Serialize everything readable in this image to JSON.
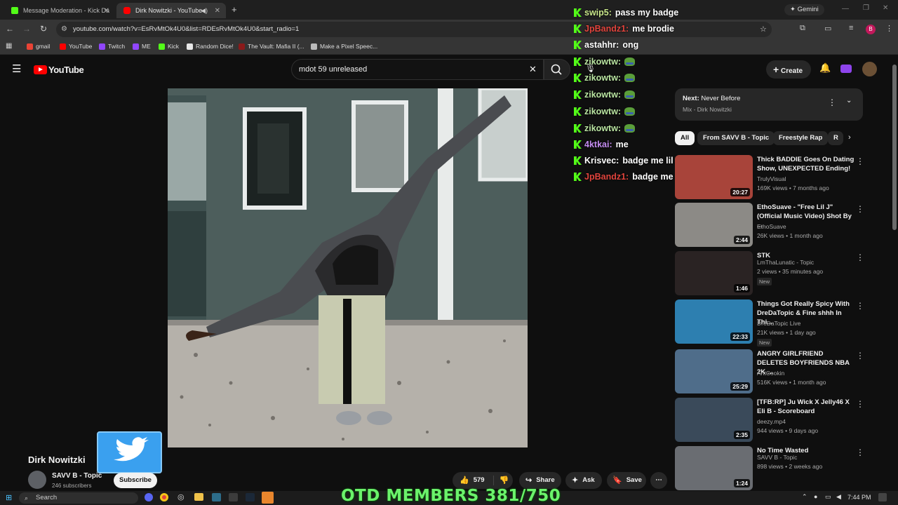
{
  "browser": {
    "tabs": [
      {
        "label": "Message Moderation - Kick Da",
        "active": false
      },
      {
        "label": "Dirk Nowitzki - YouTube",
        "active": true
      }
    ],
    "url": "youtube.com/watch?v=EsRvMtOk4U0&list=RDEsRvMtOk4U0&start_radio=1",
    "gemini_label": "Gemini",
    "profile_initial": "B",
    "bookmarks": [
      "gmail",
      "YouTube",
      "Twitch",
      "ME",
      "Kick",
      "Random Dice!",
      "The Vault: Mafia II (...",
      "Make a Pixel Speec..."
    ]
  },
  "youtube": {
    "logo_text": "YouTube",
    "search_value": "mdot 59 unreleased",
    "create_label": "Create"
  },
  "chat": [
    {
      "user": "swip5:",
      "msg": "pass my badge",
      "color": "#c8e68a"
    },
    {
      "user": "JpBandz1:",
      "msg": "me brodie",
      "color": "#e0443d"
    },
    {
      "user": "astahhr:",
      "msg": "ong",
      "color": "#ffffff"
    },
    {
      "user": "zikowtw:",
      "msg": "",
      "color": "#b9e4a1"
    },
    {
      "user": "zikowtw:",
      "msg": "",
      "color": "#b9e4a1"
    },
    {
      "user": "zikowtw:",
      "msg": "",
      "color": "#b9e4a1"
    },
    {
      "user": "zikowtw:",
      "msg": "",
      "color": "#b9e4a1"
    },
    {
      "user": "zikowtw:",
      "msg": "",
      "color": "#b9e4a1"
    },
    {
      "user": "4ktkai:",
      "msg": "me",
      "color": "#c48cf0"
    },
    {
      "user": "Krisvec:",
      "msg": "badge me lil bro",
      "color": "#ffffff"
    },
    {
      "user": "JpBandz1:",
      "msg": "badge me up",
      "color": "#e0443d"
    }
  ],
  "upnext": {
    "prefix": "Next:",
    "title": "Never Before",
    "subtitle": "Mix - Dirk Nowitzki"
  },
  "chips": [
    "All",
    "From SAVV B - Topic",
    "Freestyle Rap",
    "R"
  ],
  "recommendations": [
    {
      "title": "Thick BADDIE Goes On Dating Show, UNEXPECTED Ending!",
      "channel": "TrulyVisual",
      "meta": "169K views • 7 months ago",
      "duration": "20:27",
      "badge": "",
      "thumb": "#a8443a"
    },
    {
      "title": "EthoSuave - \"Free Lil J\" (Official Music Video) Shot By ...",
      "channel": "EthoSuave",
      "meta": "26K views • 1 month ago",
      "duration": "2:44",
      "badge": "",
      "thumb": "#8c8a86"
    },
    {
      "title": "STK",
      "channel": "LmThaLunatic - Topic",
      "meta": "2 views • 35 minutes ago",
      "duration": "1:46",
      "badge": "New",
      "thumb": "#2a2323"
    },
    {
      "title": "Things Got Really Spicy With DreDaTopic & Fine shhh In Thi...",
      "channel": "DreDaTopic Live",
      "meta": "21K views • 1 day ago",
      "duration": "22:33",
      "badge": "New",
      "thumb": "#2d7fb0"
    },
    {
      "title": "ANGRY GIRLFRIEND DELETES BOYFRIENDS NBA 2K ...",
      "channel": "AntCookin",
      "meta": "516K views • 1 month ago",
      "duration": "25:29",
      "badge": "",
      "thumb": "#4f6d8a"
    },
    {
      "title": "[TFB:RP] Ju Wick X Jelly46 X Eli B - Scoreboard",
      "channel": "deezy.mp4",
      "meta": "944 views • 9 days ago",
      "duration": "2:35",
      "badge": "",
      "thumb": "#3a4a5a"
    },
    {
      "title": "No Time Wasted",
      "channel": "SAVV B - Topic",
      "meta": "898 views • 2 weeks ago",
      "duration": "1:24",
      "badge": "",
      "thumb": "#6a6d72"
    }
  ],
  "video": {
    "title": "Dirk Nowitzki",
    "channel": "SAVV B - Topic",
    "subscribers": "246 subscribers",
    "subscribe_label": "Subscribe",
    "likes": "579",
    "share_label": "Share",
    "ask_label": "Ask",
    "save_label": "Save"
  },
  "overlay": {
    "members_text": "OTD MEMBERS 381/750"
  },
  "taskbar": {
    "search_label": "Search",
    "time": "7:44 PM"
  }
}
